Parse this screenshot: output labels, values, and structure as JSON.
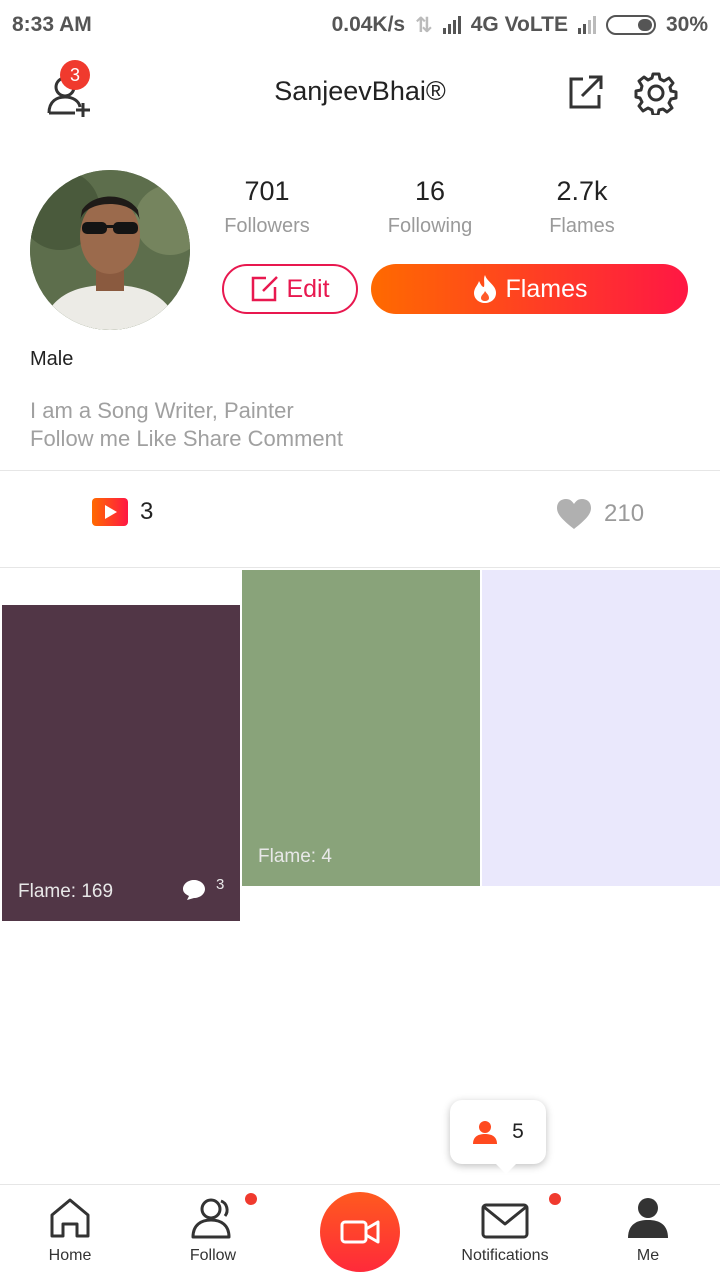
{
  "status_bar": {
    "time": "8:33 AM",
    "speed": "0.04K/s",
    "network": "4G VoLTE",
    "battery": "30%"
  },
  "header": {
    "title": "SanjeevBhai®",
    "add_friend_badge": "3"
  },
  "profile": {
    "stats": [
      {
        "value": "701",
        "label": "Followers"
      },
      {
        "value": "16",
        "label": "Following"
      },
      {
        "value": "2.7k",
        "label": "Flames"
      }
    ],
    "edit_label": "Edit",
    "flames_label": "Flames",
    "gender": "Male",
    "bio_line1": "I am a Song Writer, Painter",
    "bio_line2": "Follow me Like Share Comment"
  },
  "counts": {
    "videos": "3",
    "likes": "210"
  },
  "posts": [
    {
      "flame_label": "Flame: 169",
      "comments": "3",
      "color": "#513646"
    },
    {
      "flame_label": "Flame: 4",
      "color": "#89a37a"
    },
    {
      "color": "#eae8fc"
    }
  ],
  "popup": {
    "count": "5"
  },
  "nav": {
    "home": "Home",
    "follow": "Follow",
    "notifications": "Notifications",
    "me": "Me"
  },
  "colors": {
    "accent": "#e8184f",
    "gradient_start": "#ff6a00",
    "gradient_end": "#ff1744",
    "badge": "#f03a2e"
  }
}
